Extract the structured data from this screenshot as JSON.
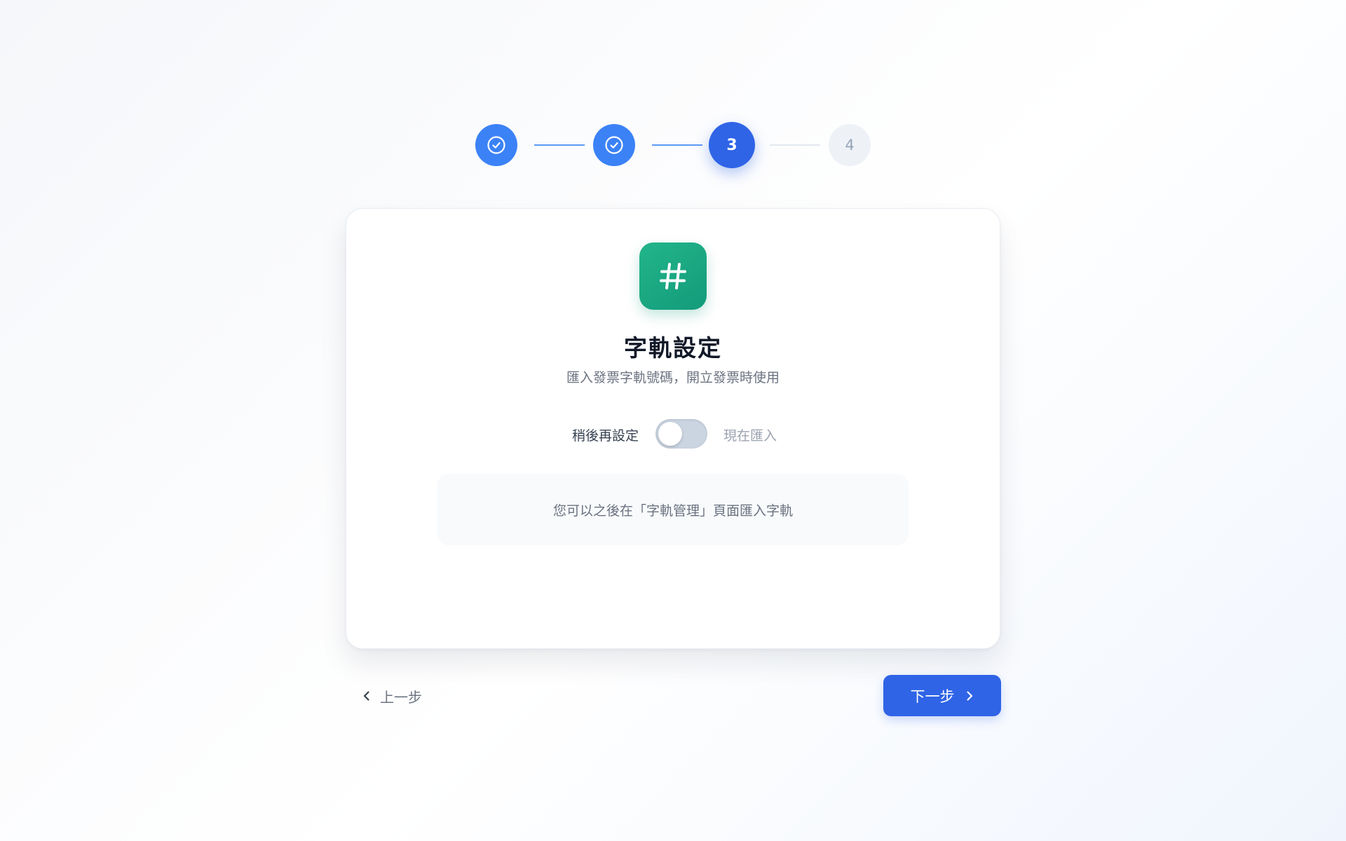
{
  "stepper": {
    "steps": [
      {
        "state": "done",
        "icon": "check-circle-icon"
      },
      {
        "state": "done",
        "icon": "check-circle-icon"
      },
      {
        "state": "active",
        "label": "3"
      },
      {
        "state": "todo",
        "label": "4"
      }
    ],
    "colors": {
      "done": "#3b82f6",
      "active": "#2f64e6",
      "todo": "#eef2f7"
    }
  },
  "card": {
    "icon": "hash-icon",
    "icon_color": "#1aa882",
    "title": "字軌設定",
    "subtitle": "匯入發票字軌號碼，開立發票時使用",
    "toggle": {
      "left_label": "稍後再設定",
      "right_label": "現在匯入",
      "on": false
    },
    "info_text": "您可以之後在「字軌管理」頁面匯入字軌"
  },
  "nav": {
    "back_label": "上一步",
    "back_icon": "chevron-left-icon",
    "next_label": "下一步",
    "next_icon": "chevron-right-icon",
    "accent": "#2f64e6"
  }
}
